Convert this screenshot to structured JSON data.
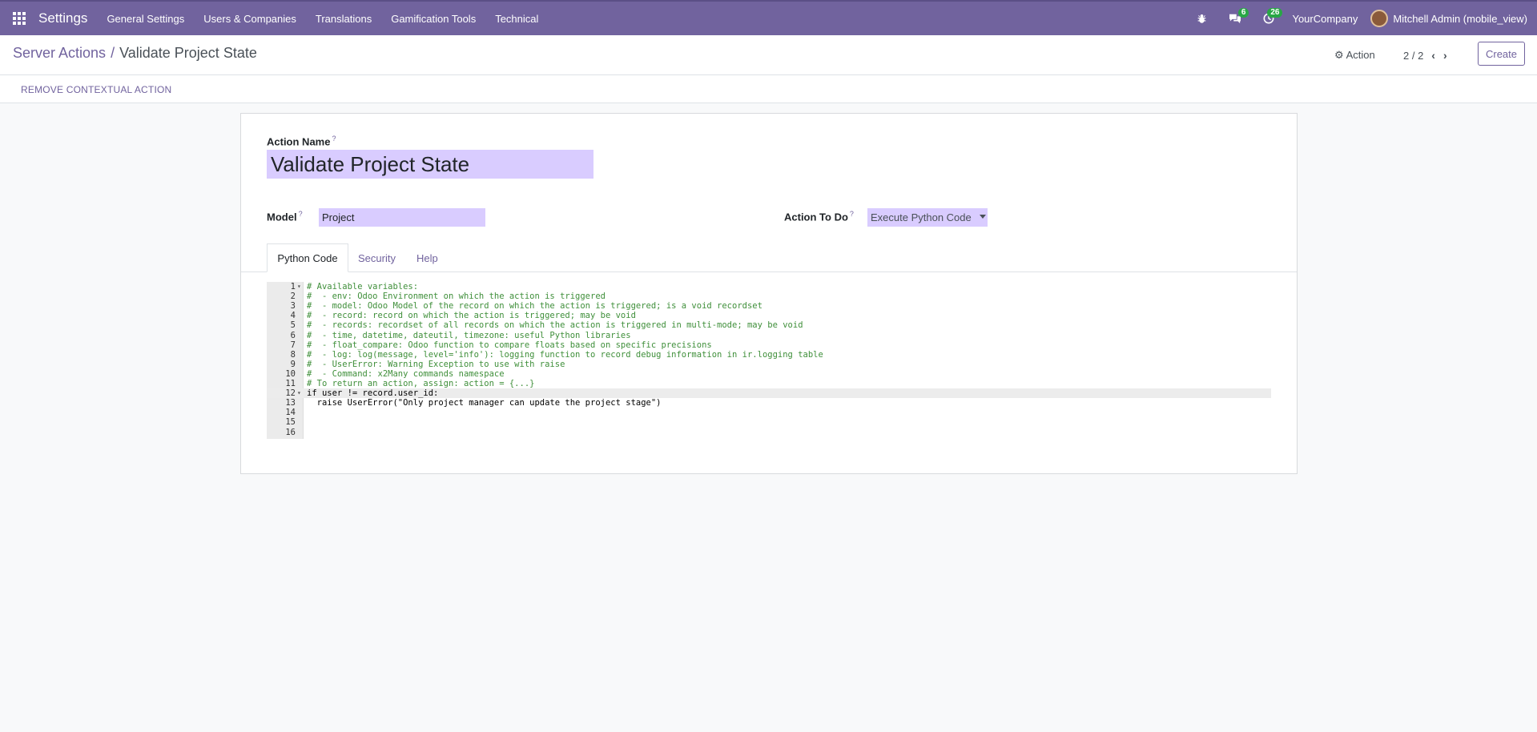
{
  "navbar": {
    "brand": "Settings",
    "menu": [
      "General Settings",
      "Users & Companies",
      "Translations",
      "Gamification Tools",
      "Technical"
    ],
    "messages_badge": "6",
    "activities_badge": "26",
    "company": "YourCompany",
    "user": "Mitchell Admin (mobile_view)"
  },
  "control": {
    "breadcrumb_parent": "Server Actions",
    "breadcrumb_sep": "/",
    "breadcrumb_current": "Validate Project State",
    "action_label": "Action",
    "pager": "2 / 2",
    "create_label": "Create"
  },
  "statusbar": {
    "remove_label": "REMOVE CONTEXTUAL ACTION"
  },
  "form": {
    "action_name_label": "Action Name",
    "action_name_value": "Validate Project State",
    "model_label": "Model",
    "model_value": "Project",
    "action_todo_label": "Action To Do",
    "action_todo_value": "Execute Python Code",
    "help_mark": "?"
  },
  "tabs": [
    "Python Code",
    "Security",
    "Help"
  ],
  "code_lines": [
    "# Available variables:",
    "#  - env: Odoo Environment on which the action is triggered",
    "#  - model: Odoo Model of the record on which the action is triggered; is a void recordset",
    "#  - record: record on which the action is triggered; may be void",
    "#  - records: recordset of all records on which the action is triggered in multi-mode; may be void",
    "#  - time, datetime, dateutil, timezone: useful Python libraries",
    "#  - float_compare: Odoo function to compare floats based on specific precisions",
    "#  - log: log(message, level='info'): logging function to record debug information in ir.logging table",
    "#  - UserError: Warning Exception to use with raise",
    "#  - Command: x2Many commands namespace",
    "# To return an action, assign: action = {...}",
    "if user != record.user_id:",
    "  raise UserError(\"Only project manager can update the project stage\")",
    "",
    "",
    ""
  ],
  "line_numbers": [
    "1",
    "2",
    "3",
    "4",
    "5",
    "6",
    "7",
    "8",
    "9",
    "10",
    "11",
    "12",
    "13",
    "14",
    "15",
    "16"
  ]
}
